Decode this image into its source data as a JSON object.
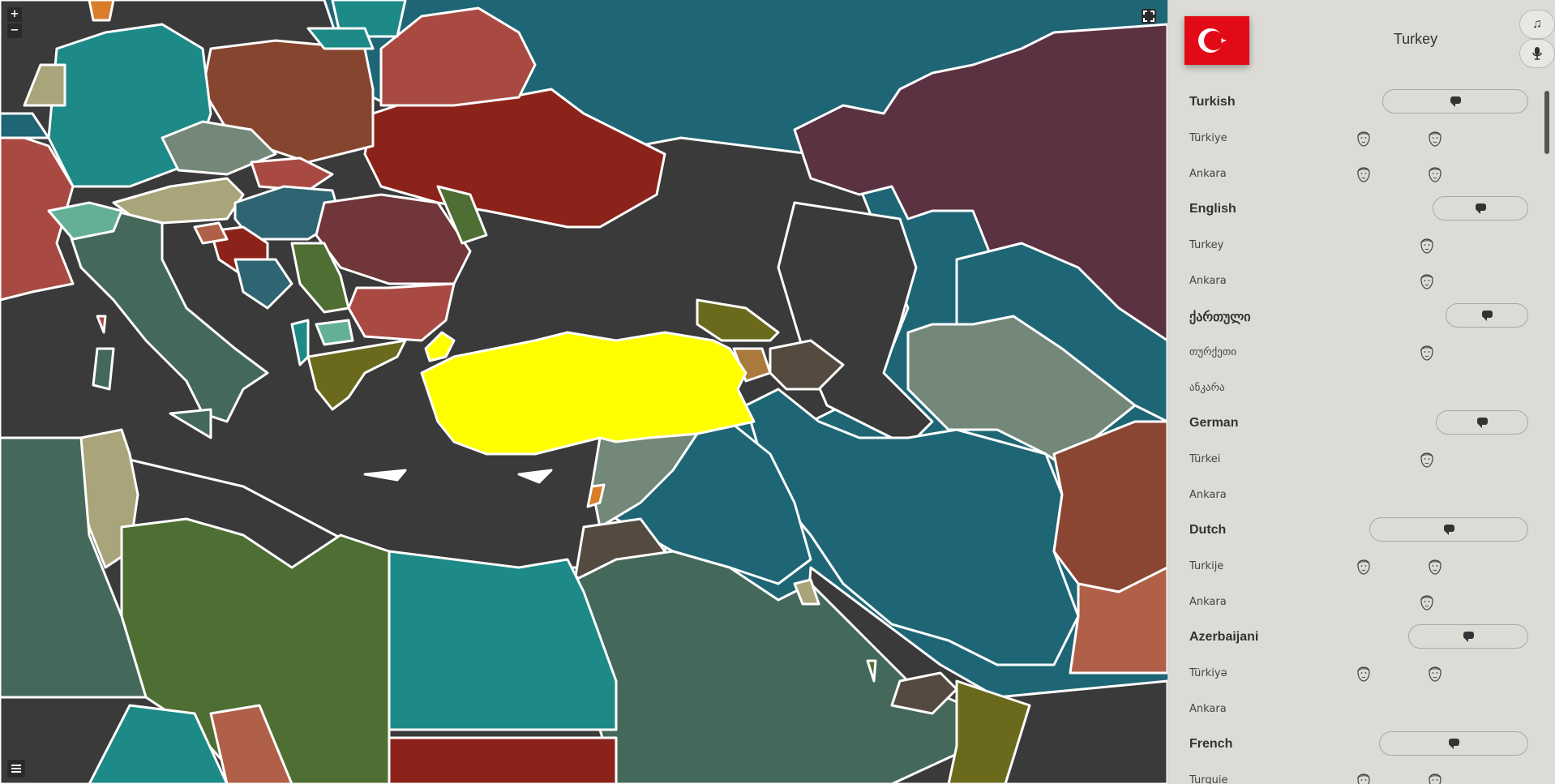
{
  "map": {
    "zoom_in": "+",
    "zoom_out": "−",
    "fullscreen_icon": "fullscreen-icon",
    "menu_icon": "menu-icon",
    "highlight_color": "#ffff00",
    "sea_color": "#1e6675",
    "land_color": "#3a3a3a"
  },
  "header": {
    "country": "Turkey",
    "flag_color": "#e30a17",
    "music_icon": "music-icon",
    "mic_icon": "mic-icon"
  },
  "languages": [
    {
      "name": "Turkish",
      "words": [
        {
          "text": "Türkiye",
          "voices": 2
        },
        {
          "text": "Ankara",
          "voices": 2
        }
      ]
    },
    {
      "name": "English",
      "words": [
        {
          "text": "Turkey",
          "voices": 1
        },
        {
          "text": "Ankara",
          "voices": 1
        }
      ]
    },
    {
      "name": "ქართული",
      "words": [
        {
          "text": "თურქეთი",
          "voices": 1
        },
        {
          "text": "ანკარა",
          "voices": 0
        }
      ]
    },
    {
      "name": "German",
      "words": [
        {
          "text": "Türkei",
          "voices": 1
        },
        {
          "text": "Ankara",
          "voices": 0
        }
      ]
    },
    {
      "name": "Dutch",
      "words": [
        {
          "text": "Turkije",
          "voices": 2
        },
        {
          "text": "Ankara",
          "voices": 1
        }
      ]
    },
    {
      "name": "Azerbaijani",
      "words": [
        {
          "text": "Türkiyə",
          "voices": 2
        },
        {
          "text": "Ankara",
          "voices": 0
        }
      ]
    },
    {
      "name": "French",
      "words": [
        {
          "text": "Turquie",
          "voices": 2
        }
      ]
    }
  ]
}
